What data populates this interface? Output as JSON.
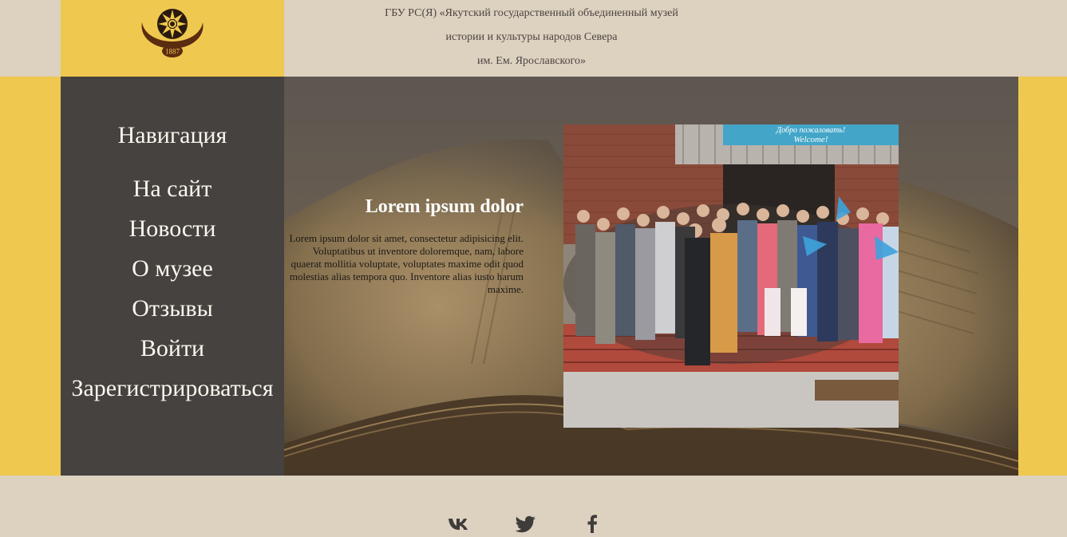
{
  "header": {
    "org_line1": "ГБУ РС(Я) «Якутский государственный объединенный музей",
    "org_line2": "истории и культуры народов Севера",
    "org_line3": "им. Ем. Ярославского»",
    "logo_year": "1887"
  },
  "nav": {
    "title": "Навигация",
    "items": [
      {
        "label": "На сайт"
      },
      {
        "label": "Новости"
      },
      {
        "label": "О музее"
      },
      {
        "label": "Отзывы"
      },
      {
        "label": "Войти"
      },
      {
        "label": "Зарегистрироваться"
      }
    ]
  },
  "content": {
    "title": "Lorem ipsum dolor",
    "body": "Lorem ipsum dolor sit amet, consectetur adipisicing elit. Voluptatibus ut inventore doloremque, nam, labore quaerat mollitia voluptate, voluptates maxime odit quod molestias alias tempora quo. Inventore alias iusto harum maxime.",
    "photo_banner_line1": "Добро пожаловать!",
    "photo_banner_line2": "Welcome!"
  },
  "footer": {
    "social": [
      {
        "icon": "vk-icon"
      },
      {
        "icon": "twitter-icon"
      },
      {
        "icon": "facebook-icon"
      }
    ]
  },
  "colors": {
    "accent_yellow": "#efc84f",
    "beige": "#ddd1c0",
    "nav_dark": "#45423f",
    "nav_text": "#fbf7ee",
    "icon_dark": "#3f3c3a"
  }
}
